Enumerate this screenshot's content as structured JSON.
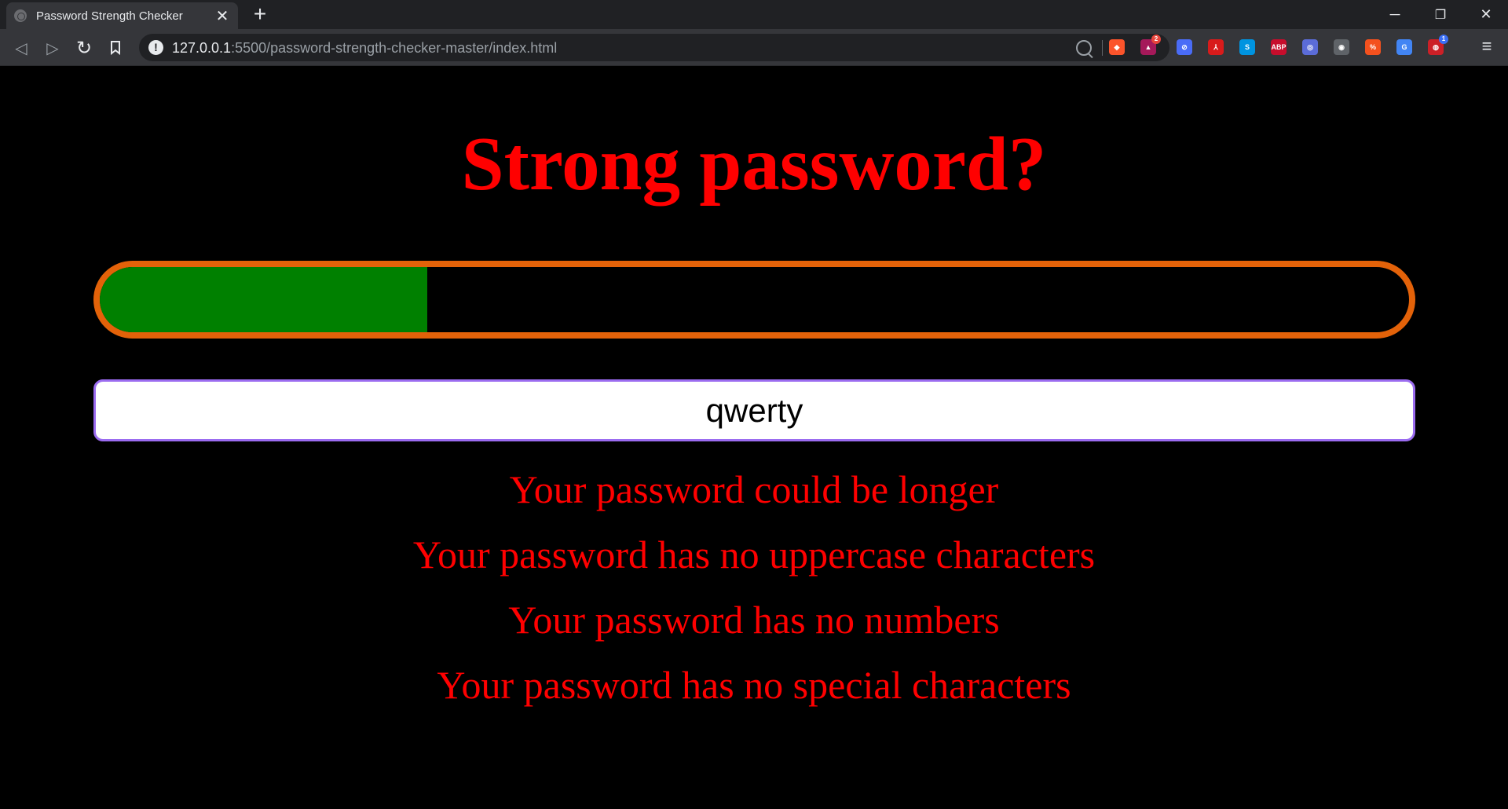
{
  "browser": {
    "tab_title": "Password Strength Checker",
    "tab_close": "✕",
    "new_tab": "+",
    "controls": {
      "minimize": "─",
      "restore": "❐",
      "close": "✕"
    },
    "nav": {
      "back": "◁",
      "forward": "▷",
      "reload": "↻",
      "bookmark": "🔖"
    },
    "url_host": "127.0.0.1",
    "url_rest": ":5500/password-strength-checker-master/index.html",
    "extensions": [
      {
        "name": "brave-shield-icon",
        "glyph": "◆",
        "color": "#fb542b"
      },
      {
        "name": "brave-rewards-icon",
        "glyph": "▲",
        "color": "#a5195a",
        "badge": "2"
      },
      {
        "name": "blocker-icon",
        "glyph": "⊘",
        "color": "#4a6cf7"
      },
      {
        "name": "pdf-icon",
        "glyph": "⅄",
        "color": "#d81b1b"
      },
      {
        "name": "skype-icon",
        "glyph": "S",
        "color": "#0094e0"
      },
      {
        "name": "adblock-plus-icon",
        "glyph": "ABP",
        "color": "#c70d2c"
      },
      {
        "name": "color-picker-icon",
        "glyph": "◎",
        "color": "#5b6cd8"
      },
      {
        "name": "screenshot-icon",
        "glyph": "◉",
        "color": "#5f6368"
      },
      {
        "name": "percent-icon",
        "glyph": "%",
        "color": "#f4511e"
      },
      {
        "name": "google-translate-icon",
        "glyph": "G",
        "color": "#4285f4"
      },
      {
        "name": "lastpass-icon",
        "glyph": "◍",
        "color": "#cc2027",
        "badge": "1"
      }
    ],
    "menu": "≡"
  },
  "page": {
    "title": "Strong password?",
    "strength_meter": {
      "fill_fraction": 0.25,
      "fill_color": "#008000",
      "border_color": "#e36209"
    },
    "password_value": "qwerty",
    "reasons": [
      "Your password could be longer",
      "Your password has no uppercase characters",
      "Your password has no numbers",
      "Your password has no special characters"
    ]
  }
}
